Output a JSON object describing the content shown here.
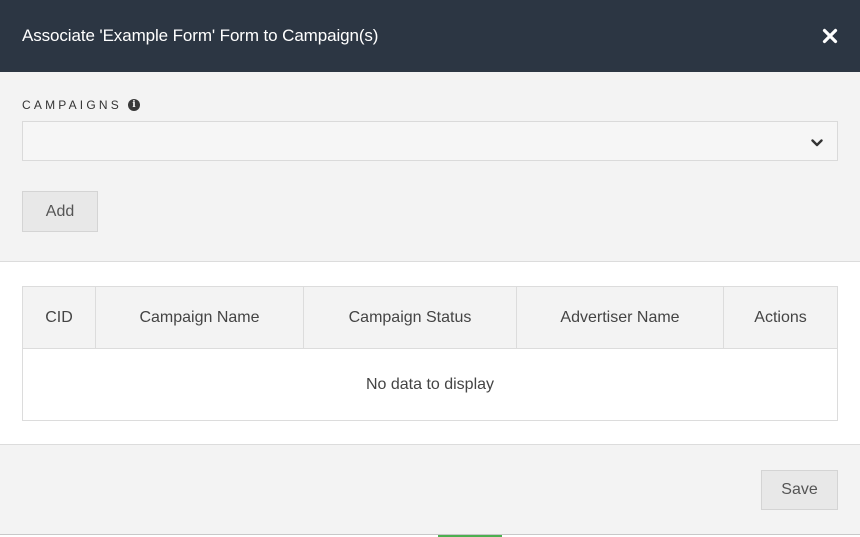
{
  "modal": {
    "title": "Associate 'Example Form' Form to Campaign(s)",
    "close_icon": "close-icon"
  },
  "campaigns_field": {
    "label": "CAMPAIGNS",
    "info_icon": "info-icon",
    "selected_value": "",
    "chevron_icon": "chevron-down-icon"
  },
  "add_button": {
    "label": "Add"
  },
  "table": {
    "columns": [
      "CID",
      "Campaign Name",
      "Campaign Status",
      "Advertiser Name",
      "Actions"
    ],
    "empty_text": "No data to display"
  },
  "save_button": {
    "label": "Save"
  },
  "colors": {
    "header_bg": "#2c3643",
    "body_bg": "#f3f3f3",
    "table_bg": "#ffffff",
    "button_bg": "#e8e8e8"
  }
}
